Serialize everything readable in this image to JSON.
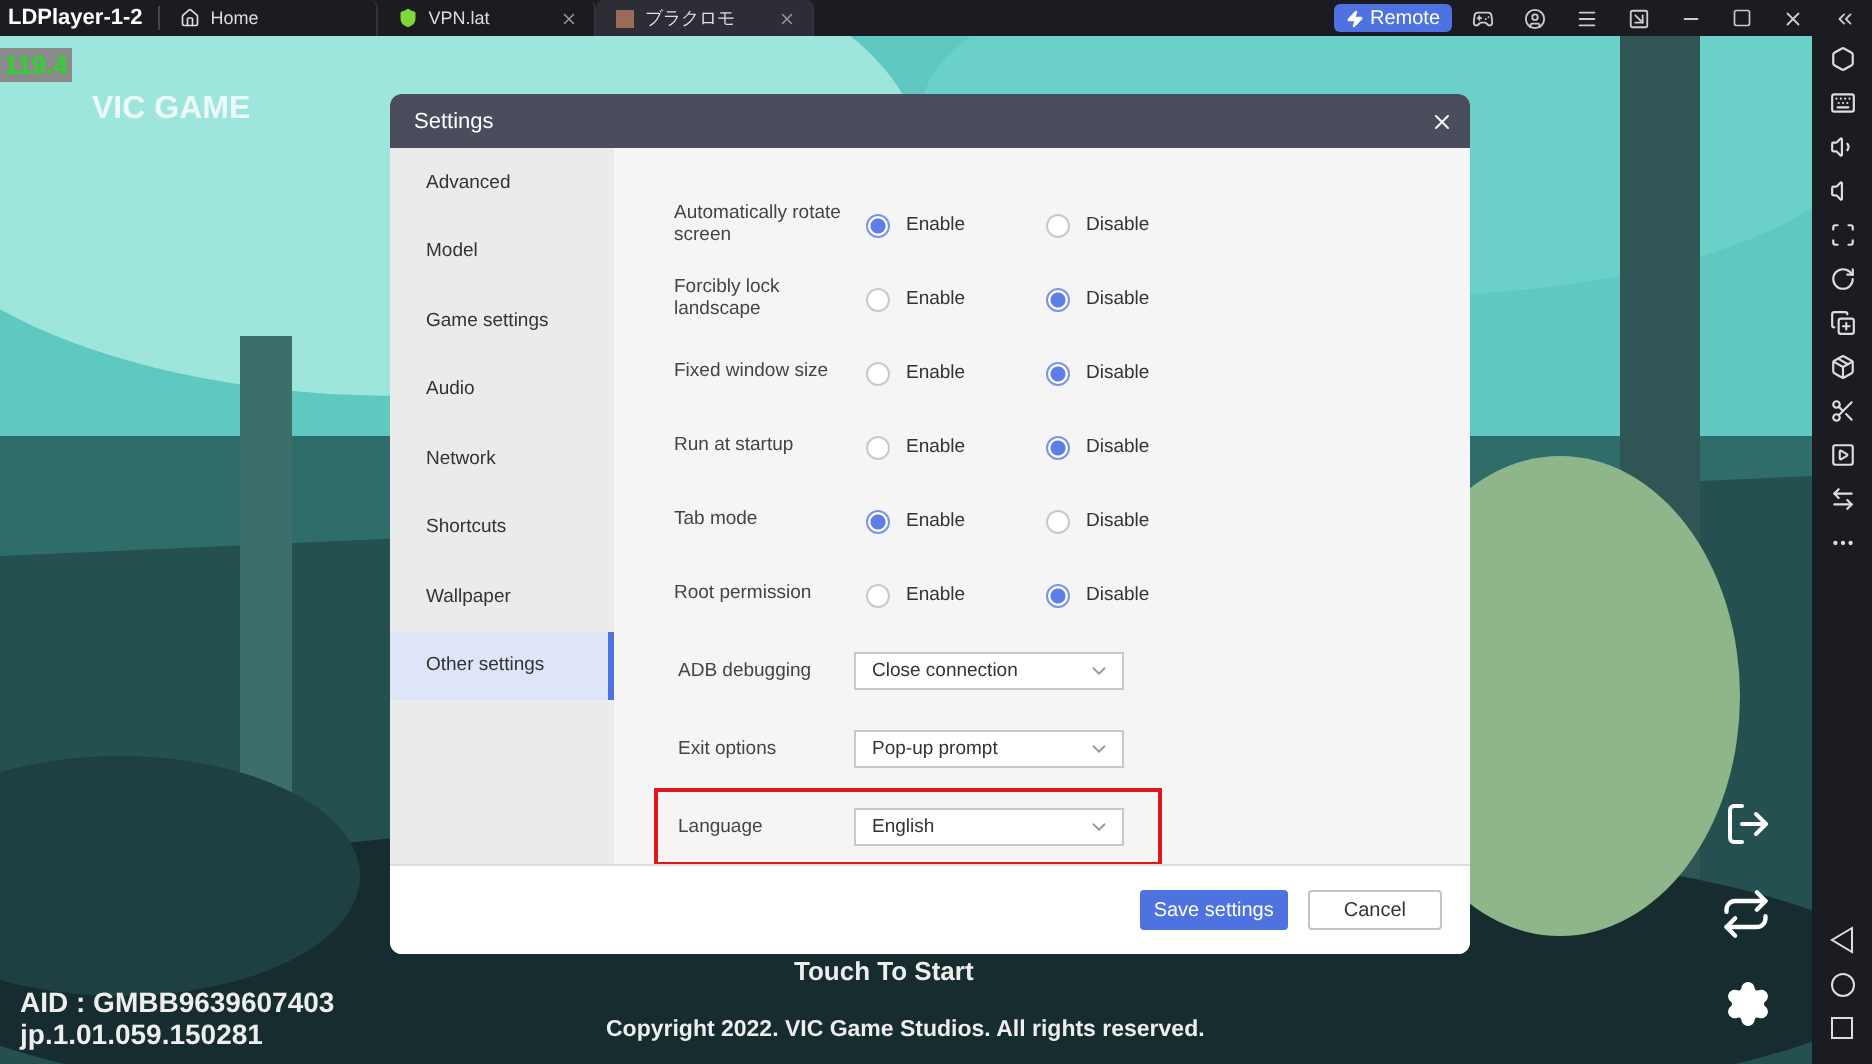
{
  "titlebar": {
    "app_name": "LDPlayer-1-2",
    "tabs": [
      {
        "label": "Home",
        "selected": false,
        "closable": false
      },
      {
        "label": "VPN.lat",
        "selected": false,
        "closable": true
      },
      {
        "label": "ブラクロモ",
        "selected": true,
        "closable": true
      }
    ],
    "remote_button": "Remote"
  },
  "game": {
    "fps": "119.4",
    "logo": "VIC GAME",
    "prompt": "Touch To Start",
    "aid": "AID : GMBB9639607403",
    "version": "jp.1.01.059.150281",
    "copyright": "Copyright 2022. VIC Game Studios. All rights reserved."
  },
  "dialog": {
    "title": "Settings",
    "nav": [
      {
        "label": "Advanced",
        "selected": false
      },
      {
        "label": "Model",
        "selected": false
      },
      {
        "label": "Game settings",
        "selected": false
      },
      {
        "label": "Audio",
        "selected": false
      },
      {
        "label": "Network",
        "selected": false
      },
      {
        "label": "Shortcuts",
        "selected": false
      },
      {
        "label": "Wallpaper",
        "selected": false
      },
      {
        "label": "Other settings",
        "selected": true
      }
    ],
    "toggles": [
      {
        "label": "Automatically rotate screen",
        "options": [
          {
            "label": "Enable",
            "selected": true
          },
          {
            "label": "Disable",
            "selected": false
          }
        ]
      },
      {
        "label": "Forcibly lock landscape",
        "options": [
          {
            "label": "Enable",
            "selected": false
          },
          {
            "label": "Disable",
            "selected": true
          }
        ]
      },
      {
        "label": "Fixed window size",
        "options": [
          {
            "label": "Enable",
            "selected": false
          },
          {
            "label": "Disable",
            "selected": true
          }
        ]
      },
      {
        "label": "Run at startup",
        "options": [
          {
            "label": "Enable",
            "selected": false
          },
          {
            "label": "Disable",
            "selected": true
          }
        ]
      },
      {
        "label": "Tab mode",
        "options": [
          {
            "label": "Enable",
            "selected": true
          },
          {
            "label": "Disable",
            "selected": false
          }
        ]
      },
      {
        "label": "Root permission",
        "options": [
          {
            "label": "Enable",
            "selected": false
          },
          {
            "label": "Disable",
            "selected": true
          }
        ]
      }
    ],
    "dropdowns": [
      {
        "label": "ADB debugging",
        "value": "Close connection",
        "highlighted": false
      },
      {
        "label": "Exit options",
        "value": "Pop-up prompt",
        "highlighted": false
      },
      {
        "label": "Language",
        "value": "English",
        "highlighted": true
      }
    ],
    "buttons": [
      {
        "label": "Save settings",
        "kind": "primary"
      },
      {
        "label": "Cancel",
        "kind": "secondary"
      }
    ]
  }
}
